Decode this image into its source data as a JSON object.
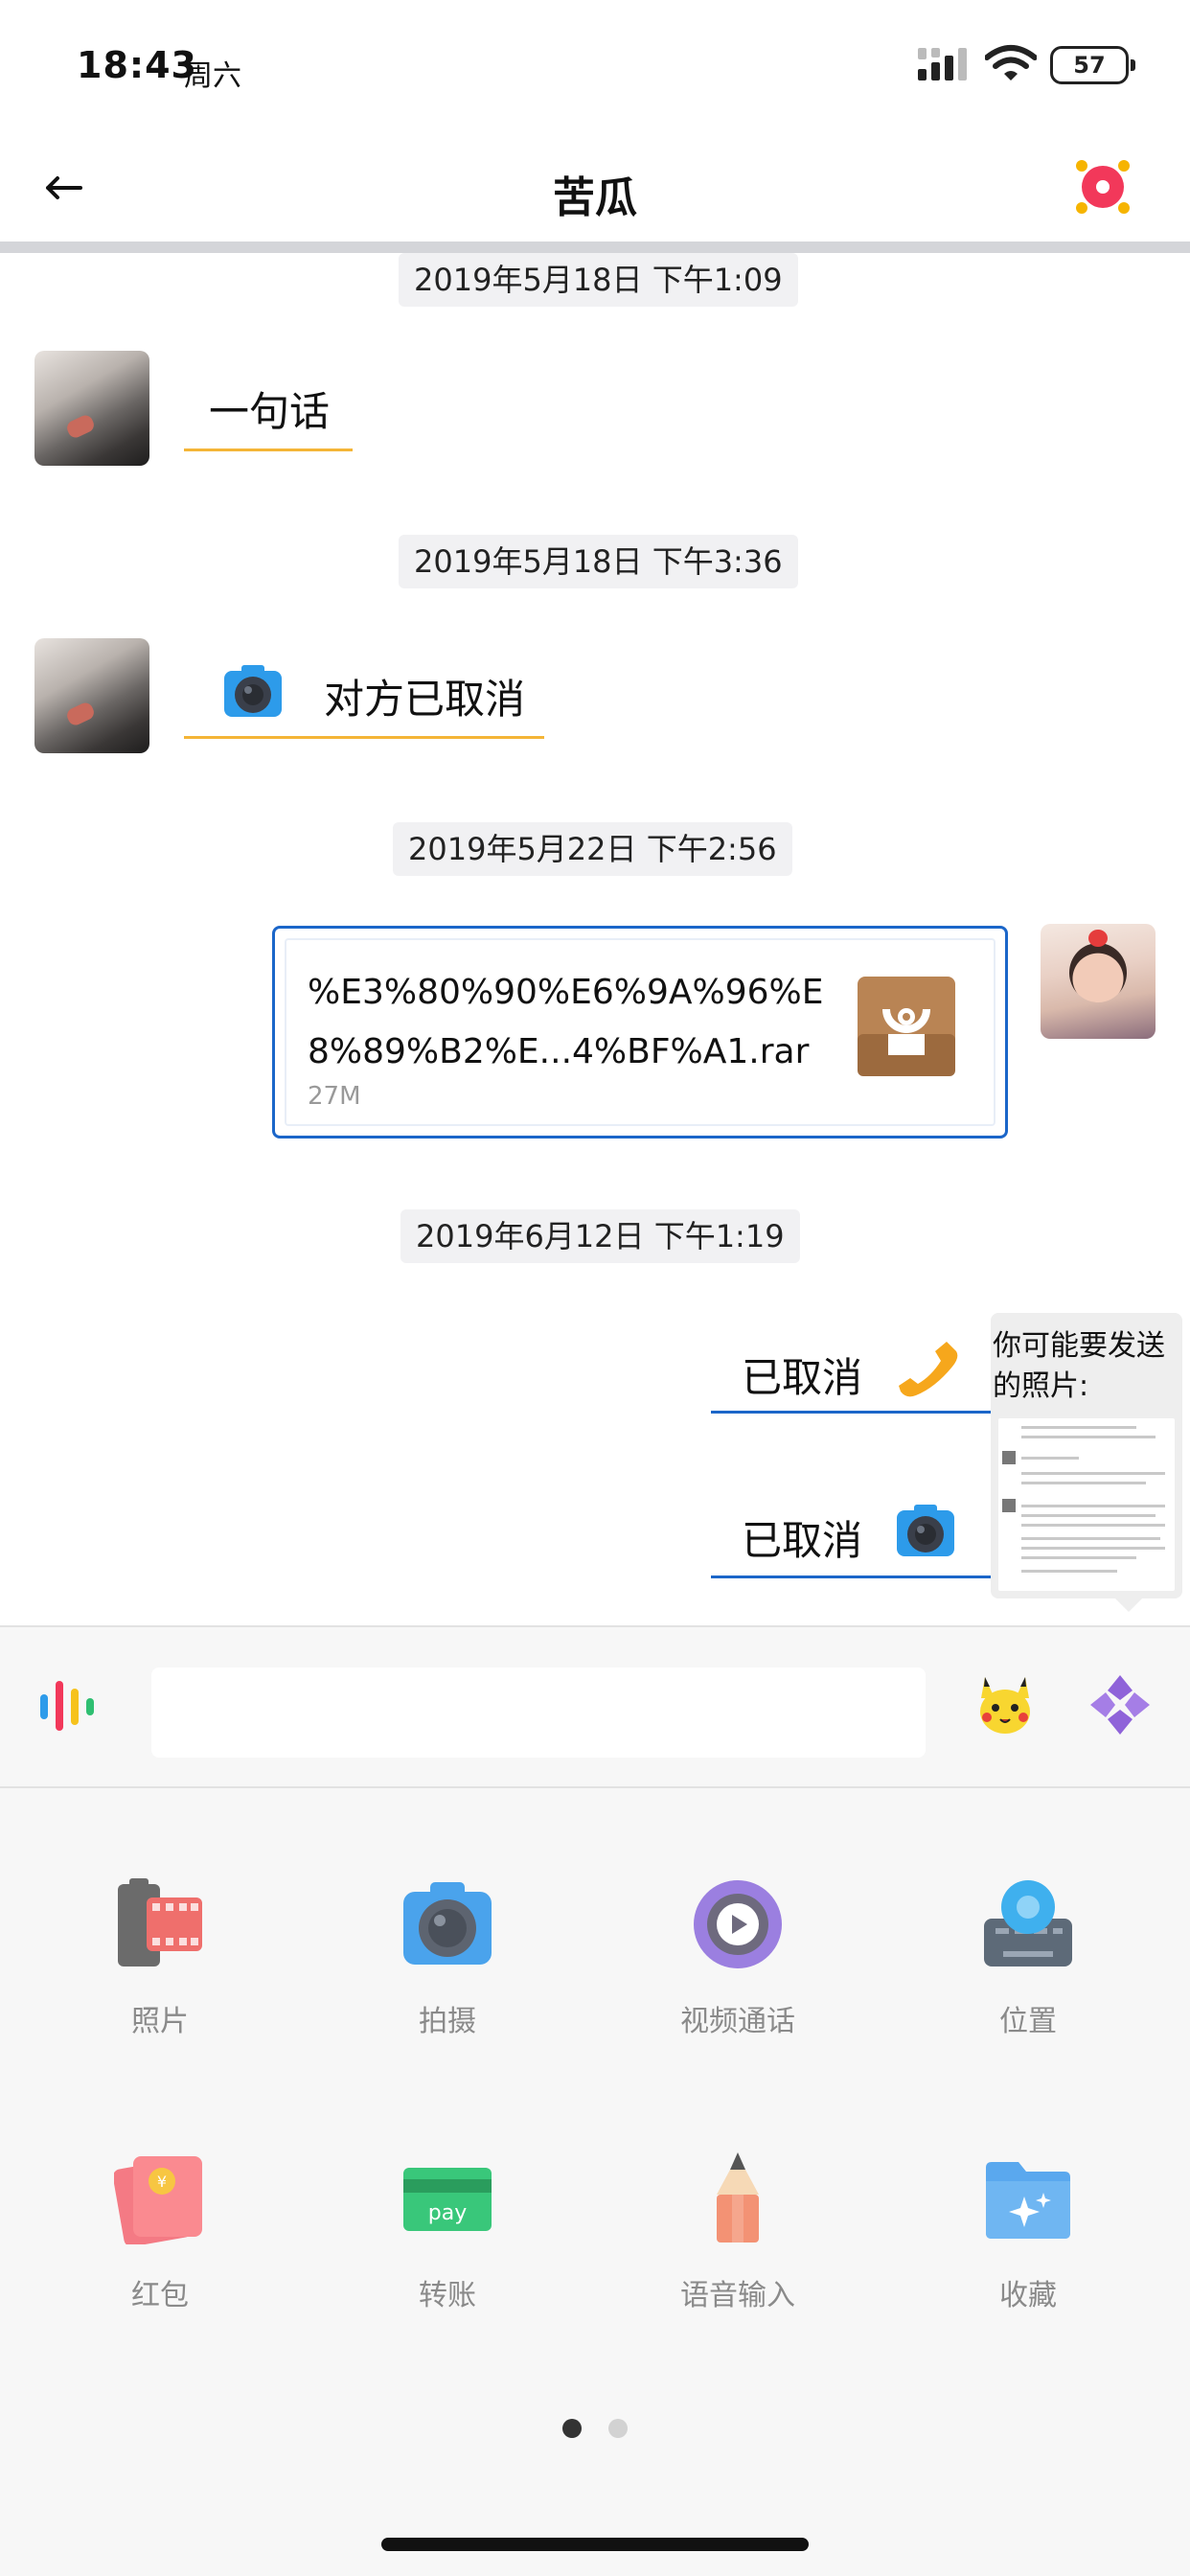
{
  "status_bar": {
    "time": "18:43",
    "day": "周六",
    "battery": "57"
  },
  "nav": {
    "title": "苦瓜"
  },
  "messages": [
    {
      "timestamp": "2019年5月18日 下午1:09",
      "text": "一句话"
    },
    {
      "timestamp": "2019年5月18日 下午3:36",
      "text": "对方已取消"
    },
    {
      "timestamp": "2019年5月22日 下午2:56",
      "file_name": "%E3%80%90%E6%9A%96%E8%89%B2%E...4%BF%A1.rar",
      "file_size": "27M"
    },
    {
      "timestamp": "2019年6月12日 下午1:19",
      "call_status_1": "已取消",
      "call_status_2": "已取消"
    }
  ],
  "photo_suggestion": {
    "text": "你可能要发送的照片:"
  },
  "input": {
    "placeholder": ""
  },
  "panel": {
    "items": [
      {
        "label": "照片",
        "icon": "photo-icon"
      },
      {
        "label": "拍摄",
        "icon": "camera-icon"
      },
      {
        "label": "视频通话",
        "icon": "video-call-icon"
      },
      {
        "label": "位置",
        "icon": "location-icon"
      },
      {
        "label": "红包",
        "icon": "red-packet-icon"
      },
      {
        "label": "转账",
        "icon": "transfer-icon"
      },
      {
        "label": "语音输入",
        "icon": "voice-input-icon"
      },
      {
        "label": "收藏",
        "icon": "favorites-icon"
      }
    ],
    "page_index": 1,
    "page_count": 2
  },
  "colors": {
    "accent_orange": "#f4b537",
    "accent_blue": "#1b66c9",
    "red_badge": "#f2385a"
  }
}
